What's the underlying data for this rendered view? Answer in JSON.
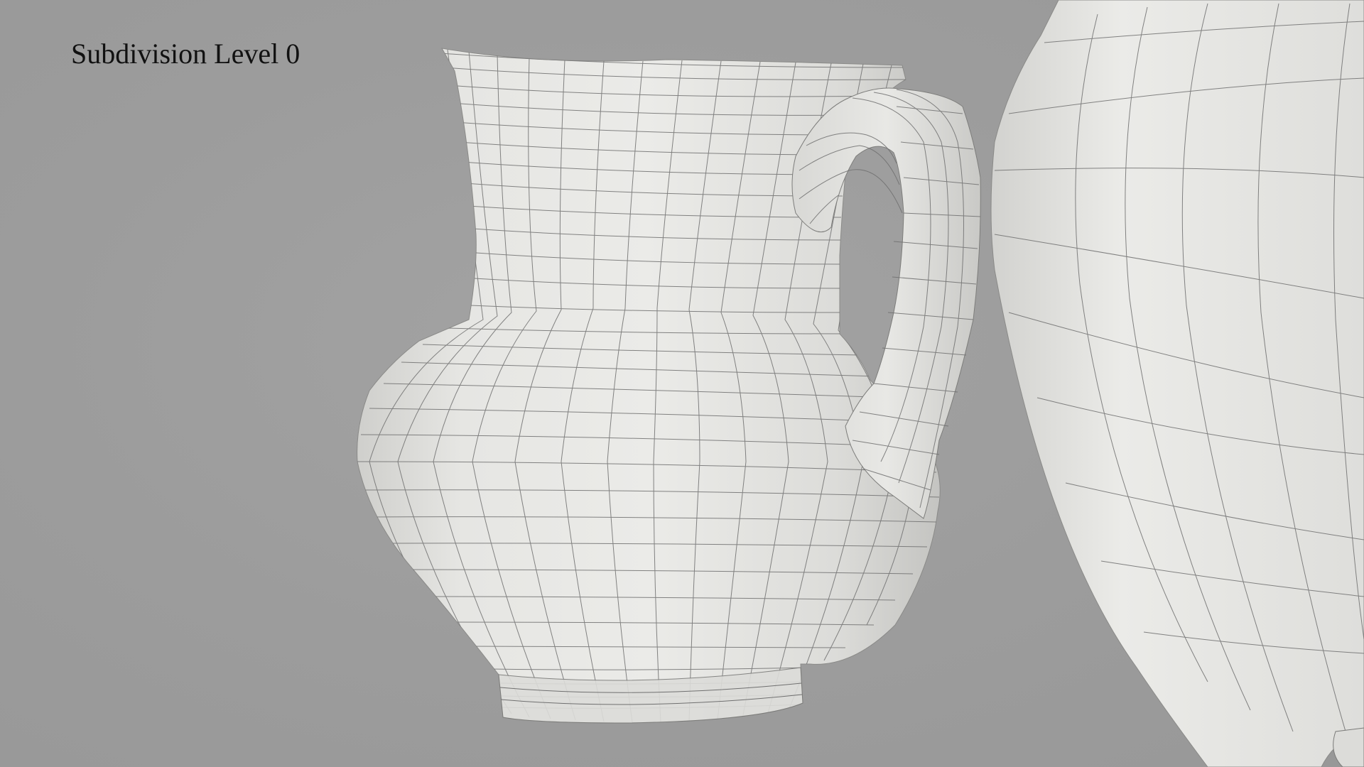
{
  "overlay": {
    "label": "Subdivision Level 0"
  },
  "scene": {
    "background_color": "#9b9b9b",
    "mesh_color": "#e2e2df",
    "wire_color": "#6f6f6f",
    "objects": [
      "pitcher-mesh",
      "second-pitcher-mesh"
    ]
  }
}
